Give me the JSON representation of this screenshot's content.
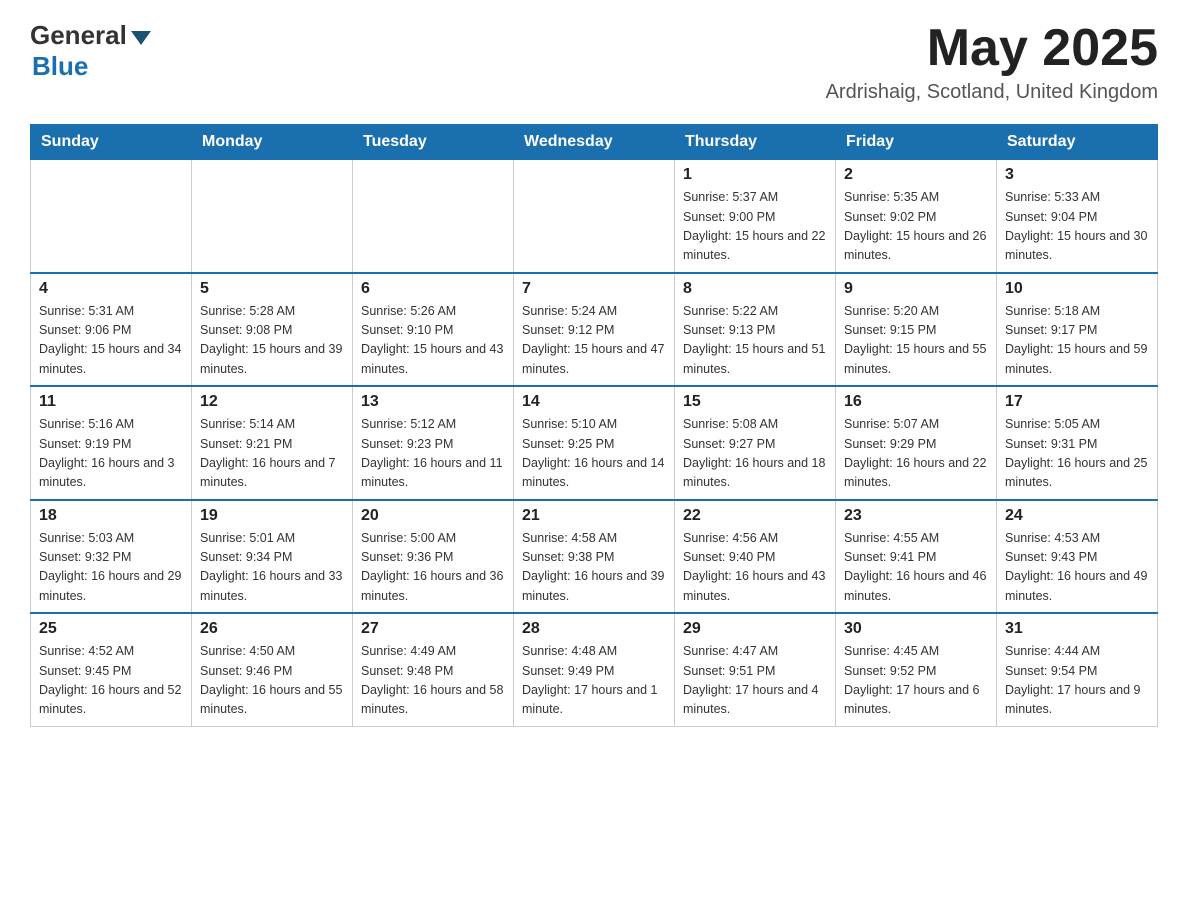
{
  "header": {
    "logo_general": "General",
    "logo_blue": "Blue",
    "month_title": "May 2025",
    "location": "Ardrishaig, Scotland, United Kingdom"
  },
  "days_of_week": [
    "Sunday",
    "Monday",
    "Tuesday",
    "Wednesday",
    "Thursday",
    "Friday",
    "Saturday"
  ],
  "weeks": [
    [
      {
        "day": "",
        "info": ""
      },
      {
        "day": "",
        "info": ""
      },
      {
        "day": "",
        "info": ""
      },
      {
        "day": "",
        "info": ""
      },
      {
        "day": "1",
        "info": "Sunrise: 5:37 AM\nSunset: 9:00 PM\nDaylight: 15 hours and 22 minutes."
      },
      {
        "day": "2",
        "info": "Sunrise: 5:35 AM\nSunset: 9:02 PM\nDaylight: 15 hours and 26 minutes."
      },
      {
        "day": "3",
        "info": "Sunrise: 5:33 AM\nSunset: 9:04 PM\nDaylight: 15 hours and 30 minutes."
      }
    ],
    [
      {
        "day": "4",
        "info": "Sunrise: 5:31 AM\nSunset: 9:06 PM\nDaylight: 15 hours and 34 minutes."
      },
      {
        "day": "5",
        "info": "Sunrise: 5:28 AM\nSunset: 9:08 PM\nDaylight: 15 hours and 39 minutes."
      },
      {
        "day": "6",
        "info": "Sunrise: 5:26 AM\nSunset: 9:10 PM\nDaylight: 15 hours and 43 minutes."
      },
      {
        "day": "7",
        "info": "Sunrise: 5:24 AM\nSunset: 9:12 PM\nDaylight: 15 hours and 47 minutes."
      },
      {
        "day": "8",
        "info": "Sunrise: 5:22 AM\nSunset: 9:13 PM\nDaylight: 15 hours and 51 minutes."
      },
      {
        "day": "9",
        "info": "Sunrise: 5:20 AM\nSunset: 9:15 PM\nDaylight: 15 hours and 55 minutes."
      },
      {
        "day": "10",
        "info": "Sunrise: 5:18 AM\nSunset: 9:17 PM\nDaylight: 15 hours and 59 minutes."
      }
    ],
    [
      {
        "day": "11",
        "info": "Sunrise: 5:16 AM\nSunset: 9:19 PM\nDaylight: 16 hours and 3 minutes."
      },
      {
        "day": "12",
        "info": "Sunrise: 5:14 AM\nSunset: 9:21 PM\nDaylight: 16 hours and 7 minutes."
      },
      {
        "day": "13",
        "info": "Sunrise: 5:12 AM\nSunset: 9:23 PM\nDaylight: 16 hours and 11 minutes."
      },
      {
        "day": "14",
        "info": "Sunrise: 5:10 AM\nSunset: 9:25 PM\nDaylight: 16 hours and 14 minutes."
      },
      {
        "day": "15",
        "info": "Sunrise: 5:08 AM\nSunset: 9:27 PM\nDaylight: 16 hours and 18 minutes."
      },
      {
        "day": "16",
        "info": "Sunrise: 5:07 AM\nSunset: 9:29 PM\nDaylight: 16 hours and 22 minutes."
      },
      {
        "day": "17",
        "info": "Sunrise: 5:05 AM\nSunset: 9:31 PM\nDaylight: 16 hours and 25 minutes."
      }
    ],
    [
      {
        "day": "18",
        "info": "Sunrise: 5:03 AM\nSunset: 9:32 PM\nDaylight: 16 hours and 29 minutes."
      },
      {
        "day": "19",
        "info": "Sunrise: 5:01 AM\nSunset: 9:34 PM\nDaylight: 16 hours and 33 minutes."
      },
      {
        "day": "20",
        "info": "Sunrise: 5:00 AM\nSunset: 9:36 PM\nDaylight: 16 hours and 36 minutes."
      },
      {
        "day": "21",
        "info": "Sunrise: 4:58 AM\nSunset: 9:38 PM\nDaylight: 16 hours and 39 minutes."
      },
      {
        "day": "22",
        "info": "Sunrise: 4:56 AM\nSunset: 9:40 PM\nDaylight: 16 hours and 43 minutes."
      },
      {
        "day": "23",
        "info": "Sunrise: 4:55 AM\nSunset: 9:41 PM\nDaylight: 16 hours and 46 minutes."
      },
      {
        "day": "24",
        "info": "Sunrise: 4:53 AM\nSunset: 9:43 PM\nDaylight: 16 hours and 49 minutes."
      }
    ],
    [
      {
        "day": "25",
        "info": "Sunrise: 4:52 AM\nSunset: 9:45 PM\nDaylight: 16 hours and 52 minutes."
      },
      {
        "day": "26",
        "info": "Sunrise: 4:50 AM\nSunset: 9:46 PM\nDaylight: 16 hours and 55 minutes."
      },
      {
        "day": "27",
        "info": "Sunrise: 4:49 AM\nSunset: 9:48 PM\nDaylight: 16 hours and 58 minutes."
      },
      {
        "day": "28",
        "info": "Sunrise: 4:48 AM\nSunset: 9:49 PM\nDaylight: 17 hours and 1 minute."
      },
      {
        "day": "29",
        "info": "Sunrise: 4:47 AM\nSunset: 9:51 PM\nDaylight: 17 hours and 4 minutes."
      },
      {
        "day": "30",
        "info": "Sunrise: 4:45 AM\nSunset: 9:52 PM\nDaylight: 17 hours and 6 minutes."
      },
      {
        "day": "31",
        "info": "Sunrise: 4:44 AM\nSunset: 9:54 PM\nDaylight: 17 hours and 9 minutes."
      }
    ]
  ]
}
